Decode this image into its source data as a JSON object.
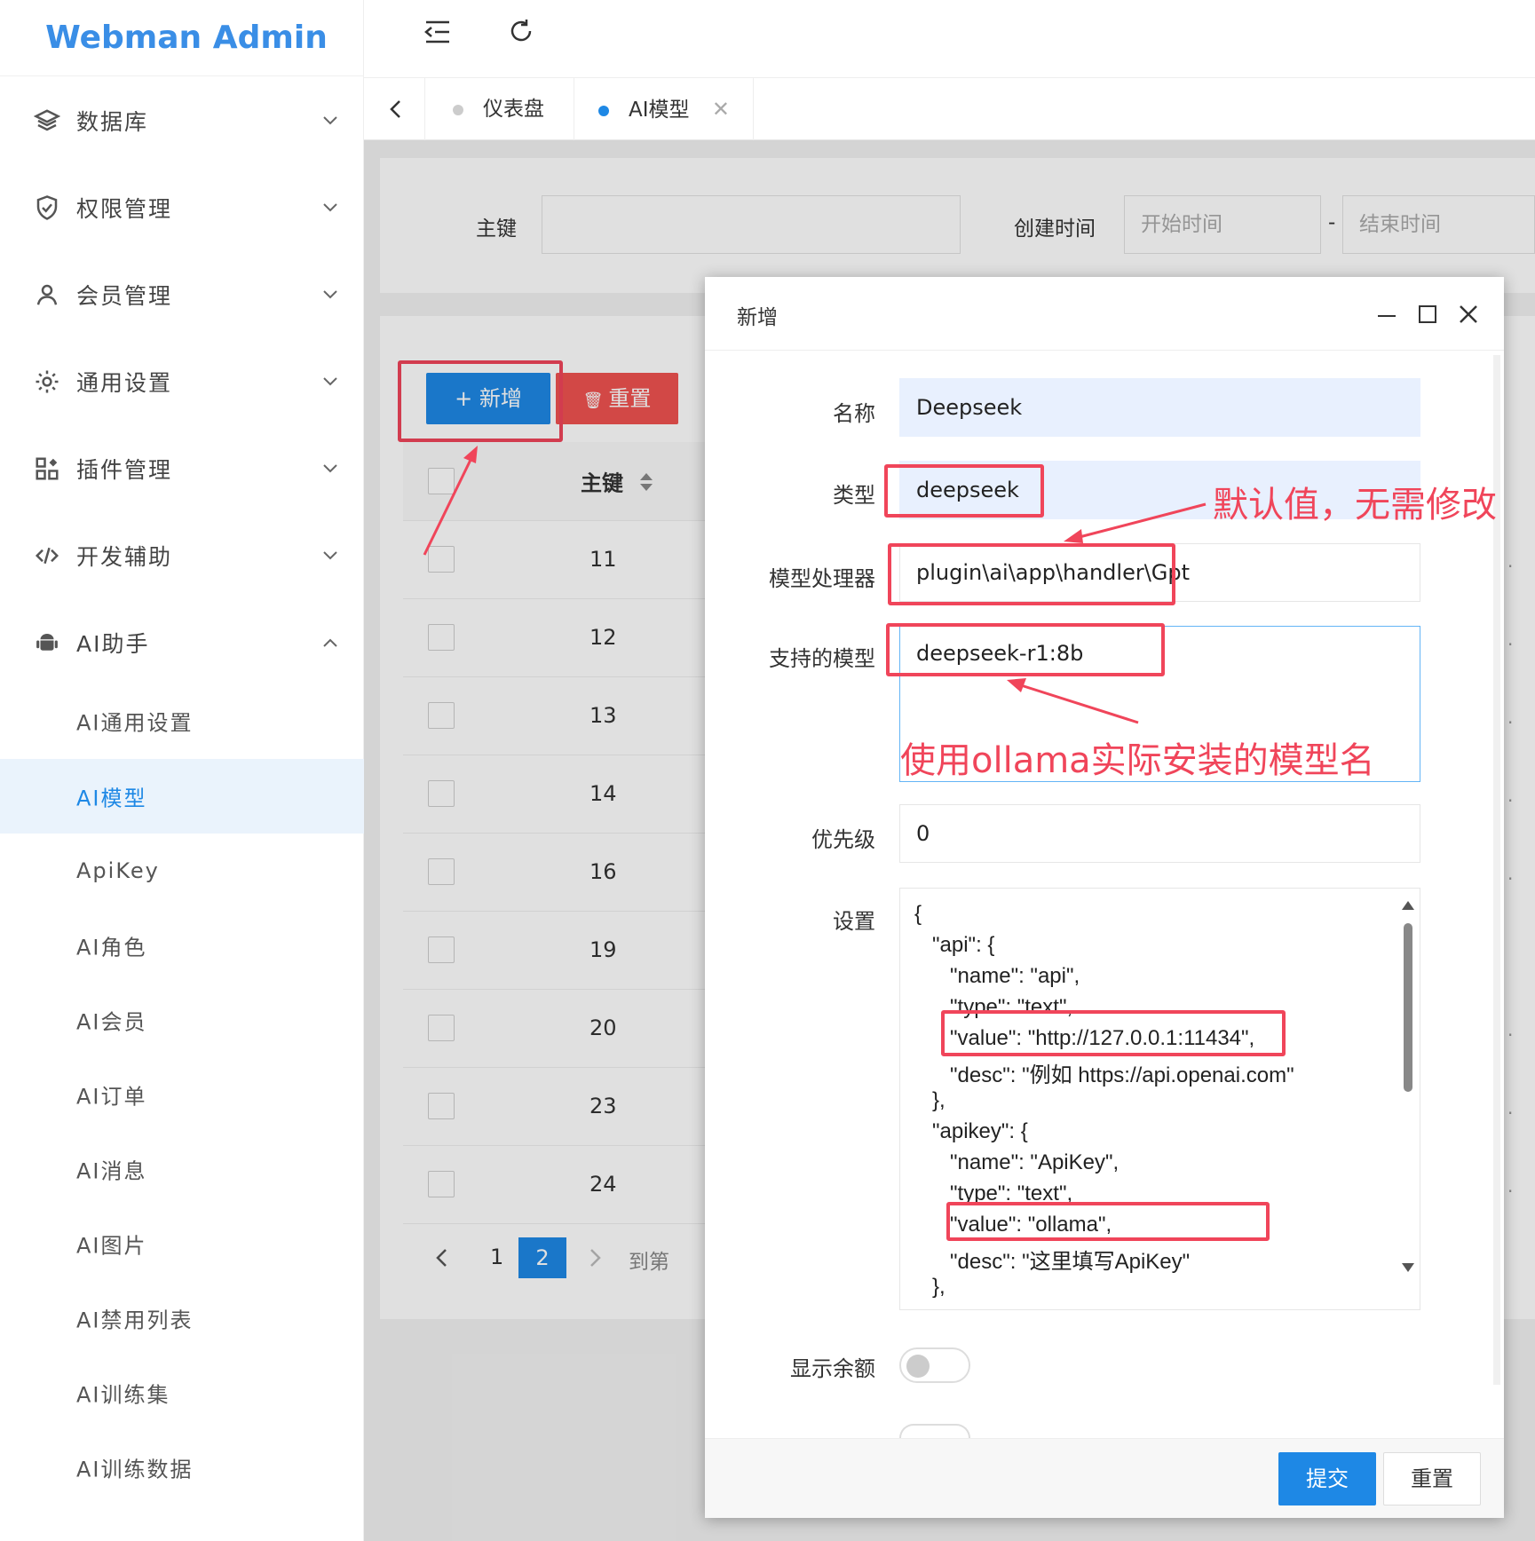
{
  "app": {
    "title": "Webman Admin"
  },
  "sidebar": {
    "groups": [
      {
        "label": "数据库",
        "icon": "layers-icon"
      },
      {
        "label": "权限管理",
        "icon": "shield-icon"
      },
      {
        "label": "会员管理",
        "icon": "user-icon"
      },
      {
        "label": "通用设置",
        "icon": "gear-icon"
      },
      {
        "label": "插件管理",
        "icon": "apps-icon"
      },
      {
        "label": "开发辅助",
        "icon": "code-icon"
      },
      {
        "label": "AI助手",
        "icon": "android-icon"
      }
    ],
    "ai_items": [
      "AI通用设置",
      "AI模型",
      "ApiKey",
      "AI角色",
      "AI会员",
      "AI订单",
      "AI消息",
      "AI图片",
      "AI禁用列表",
      "AI训练集",
      "AI训练数据"
    ],
    "active_item": "AI模型"
  },
  "tabs": [
    {
      "label": "仪表盘"
    },
    {
      "label": "AI模型"
    }
  ],
  "search": {
    "pk_label": "主键",
    "created_label": "创建时间",
    "start_placeholder": "开始时间",
    "end_placeholder": "结束时间",
    "range_sep": "-"
  },
  "toolbar": {
    "add_label": "+ 新增",
    "reset_label": "重置"
  },
  "table": {
    "col_pk": "主键",
    "rows": [
      "11",
      "12",
      "13",
      "14",
      "16",
      "19",
      "20",
      "23",
      "24"
    ]
  },
  "pagination": {
    "pages": [
      "1",
      "2"
    ],
    "current": "2",
    "goto_label": "到第"
  },
  "modal": {
    "title": "新增",
    "fields": {
      "name_label": "名称",
      "name_value": "Deepseek",
      "type_label": "类型",
      "type_value": "deepseek",
      "handler_label": "模型处理器",
      "handler_value": "plugin\\ai\\app\\handler\\Gpt",
      "models_label": "支持的模型",
      "models_value": "deepseek-r1:8b",
      "priority_label": "优先级",
      "priority_value": "0",
      "settings_label": "设置",
      "balance_label": "显示余额"
    },
    "settings_lines": [
      "{",
      "   \"api\": {",
      "      \"name\": \"api\",",
      "      \"type\": \"text\",",
      "      \"value\": \"http://127.0.0.1:11434\",",
      "      \"desc\": \"例如 https://api.openai.com\"",
      "   },",
      "   \"apikey\": {",
      "      \"name\": \"ApiKey\",",
      "      \"type\": \"text\",",
      "      \"value\": \"ollama\",",
      "      \"desc\": \"这里填写ApiKey\"",
      "   },"
    ],
    "submit_label": "提交",
    "reset_label": "重置"
  },
  "annotations": {
    "default_note": "默认值，无需修改",
    "model_note": "使用ollama实际安装的模型名"
  },
  "colors": {
    "primary": "#1e88e5",
    "danger": "#ef5350",
    "annotation": "#f0455a",
    "brand": "#3a8ee6"
  }
}
